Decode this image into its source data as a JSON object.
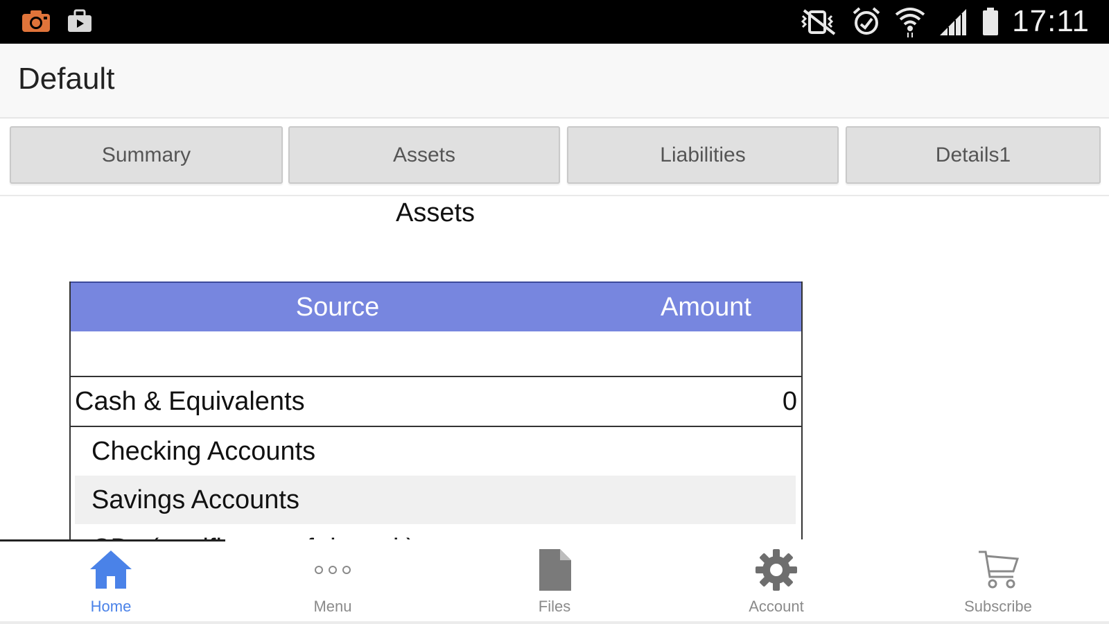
{
  "status_bar": {
    "time": "17:11",
    "left_icons": [
      "camera-icon",
      "briefcase-icon"
    ],
    "right_icons": [
      "vibrate-mute-icon",
      "alarm-icon",
      "wifi-icon",
      "signal-icon",
      "battery-icon"
    ]
  },
  "app_bar": {
    "title": "Default"
  },
  "tabs": [
    {
      "label": "Summary"
    },
    {
      "label": "Assets"
    },
    {
      "label": "Liabilities"
    },
    {
      "label": "Details1"
    }
  ],
  "section": {
    "title": "Assets"
  },
  "table": {
    "columns": {
      "source": "Source",
      "amount": "Amount"
    },
    "group": {
      "label": "Cash & Equivalents",
      "amount": "0"
    },
    "rows": [
      {
        "label": "Checking Accounts"
      },
      {
        "label": "Savings Accounts"
      },
      {
        "label": "CDs (certificates of deposit)"
      }
    ]
  },
  "bottom_nav": {
    "items": [
      {
        "label": "Home",
        "icon": "home-icon",
        "active": true
      },
      {
        "label": "Menu",
        "icon": "more-dots-icon",
        "active": false
      },
      {
        "label": "Files",
        "icon": "file-icon",
        "active": false
      },
      {
        "label": "Account",
        "icon": "gear-icon",
        "active": false
      },
      {
        "label": "Subscribe",
        "icon": "cart-icon",
        "active": false
      }
    ]
  },
  "colors": {
    "header_blue": "#7786df",
    "active_blue": "#4a82e8",
    "tab_bg": "#e0e0e0",
    "status_bar_bg": "#000000"
  }
}
